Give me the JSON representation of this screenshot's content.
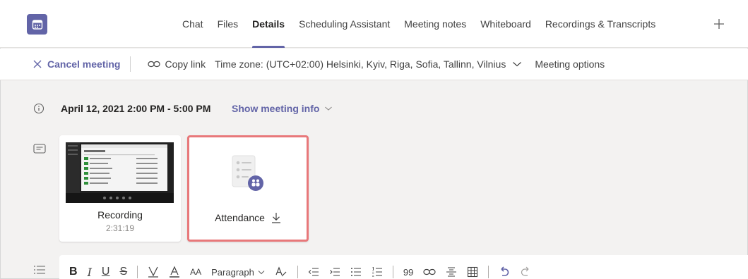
{
  "tabs": [
    {
      "label": "Chat"
    },
    {
      "label": "Files"
    },
    {
      "label": "Details"
    },
    {
      "label": "Scheduling Assistant"
    },
    {
      "label": "Meeting notes"
    },
    {
      "label": "Whiteboard"
    },
    {
      "label": "Recordings & Transcripts"
    }
  ],
  "active_tab": "Details",
  "toolbar": {
    "cancel_label": "Cancel meeting",
    "copy_link_label": "Copy link",
    "timezone_label": "Time zone: (UTC+02:00) Helsinki, Kyiv, Riga, Sofia, Tallinn, Vilnius",
    "meeting_options_label": "Meeting options"
  },
  "meeting": {
    "datetime": "April 12, 2021 2:00 PM - 5:00 PM",
    "show_info_label": "Show meeting info"
  },
  "cards": {
    "recording_label": "Recording",
    "recording_duration": "2:31:19",
    "attendance_label": "Attendance"
  },
  "editor": {
    "bold": "B",
    "italic": "I",
    "underline": "U",
    "strike": "S",
    "font_size": "AA",
    "paragraph_label": "Paragraph",
    "quote": "99"
  },
  "colors": {
    "accent": "#6264a7",
    "highlight_border": "#e8787a",
    "background": "#f3f2f1"
  }
}
